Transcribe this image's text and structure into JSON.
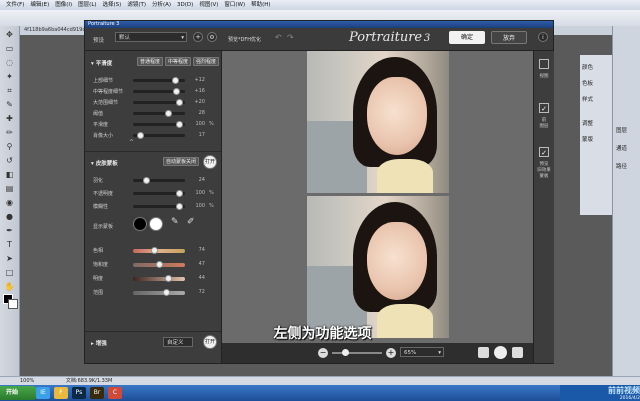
{
  "ps": {
    "menu": [
      "文件(F)",
      "编辑(E)",
      "图像(I)",
      "图层(L)",
      "选择(S)",
      "滤镜(T)",
      "分析(A)",
      "3D(D)",
      "视图(V)",
      "窗口(W)",
      "帮助(H)"
    ],
    "doc_tab": "4f118b9a6ba044cd919d.jpg @ 100% (RGB/8)",
    "status_zoom": "100%",
    "status_doc": "文档:683.9K/1.33M",
    "panel_items": [
      "颜色",
      "色板",
      "样式",
      "调整",
      "蒙版",
      "图层",
      "通道",
      "路径"
    ]
  },
  "plugin": {
    "window_title": "Portraiture 3",
    "preset_label": "预设",
    "preset_value": "默认",
    "preview_label": "预览*DFH优化",
    "brand": "Portraiture",
    "brand_version": "3",
    "ok_label": "确定",
    "cancel_label": "放弃",
    "smoothing": {
      "title": "平滑度",
      "presets": [
        "普通程度",
        "中等程度",
        "强烈程度"
      ],
      "sliders": [
        {
          "label": "上部细节",
          "value": "+12",
          "unit": "",
          "pos": 0.82
        },
        {
          "label": "中等程度细节",
          "value": "+16",
          "unit": "",
          "pos": 0.84
        },
        {
          "label": "大范围细节",
          "value": "+20",
          "unit": "",
          "pos": 0.9
        },
        {
          "label": "阈值",
          "value": "28",
          "unit": "",
          "pos": 0.68
        },
        {
          "label": "平滑度",
          "value": "100",
          "unit": "%",
          "pos": 0.9
        },
        {
          "label": "肖像大小",
          "value": "17",
          "unit": "",
          "pos": 0.15
        }
      ]
    },
    "mask": {
      "title": "皮肤蒙板",
      "auto_label": "自动蒙板关闭",
      "open_label": "打开",
      "show_mask_label": "显示蒙板",
      "sliders_top": [
        {
          "label": "羽化",
          "value": "24",
          "unit": "",
          "pos": 0.25
        },
        {
          "label": "不透明度",
          "value": "100",
          "unit": "%",
          "pos": 0.9
        },
        {
          "label": "模糊性",
          "value": "100",
          "unit": "%",
          "pos": 0.9
        }
      ],
      "sliders_bottom": [
        {
          "label": "色相",
          "value": "74",
          "unit": "",
          "pos": 0.42
        },
        {
          "label": "饱和度",
          "value": "47",
          "unit": "",
          "pos": 0.5
        },
        {
          "label": "明度",
          "value": "44",
          "unit": "",
          "pos": 0.68
        },
        {
          "label": "范围",
          "value": "72",
          "unit": "",
          "pos": 0.65
        }
      ]
    },
    "enhance": {
      "title": "增强",
      "custom_label": "自定义",
      "open_label": "打开"
    },
    "right_labels": [
      "视图",
      "前\n图层",
      "预览\n旧效果\n蒙板"
    ],
    "zoom_value": "65%"
  },
  "subtitle": "左侧为功能选项",
  "taskbar": {
    "start": "开始",
    "apps": [
      "IE",
      "F",
      "Ps",
      "Br",
      "C"
    ],
    "watermark": "前前视频",
    "date": "2016/4/2"
  }
}
